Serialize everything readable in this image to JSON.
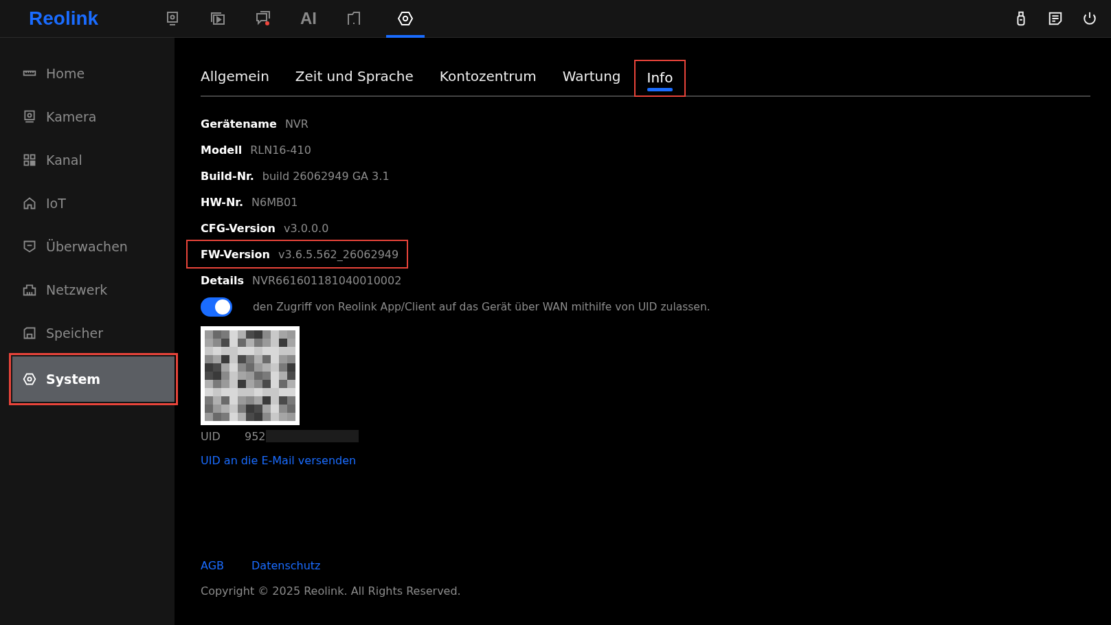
{
  "logo": "Reolink",
  "top_nav": [
    {
      "kind": "icon",
      "selected": false
    },
    {
      "kind": "icon",
      "selected": false
    },
    {
      "kind": "icon",
      "selected": false
    },
    {
      "kind": "text",
      "label": "AI",
      "selected": false
    },
    {
      "kind": "icon",
      "selected": false
    },
    {
      "kind": "icon",
      "selected": true
    }
  ],
  "sidebar": {
    "items": [
      {
        "label": "Home",
        "selected": false,
        "highlighted": false
      },
      {
        "label": "Kamera",
        "selected": false,
        "highlighted": false
      },
      {
        "label": "Kanal",
        "selected": false,
        "highlighted": false
      },
      {
        "label": "IoT",
        "selected": false,
        "highlighted": false
      },
      {
        "label": "Überwachen",
        "selected": false,
        "highlighted": false
      },
      {
        "label": "Netzwerk",
        "selected": false,
        "highlighted": false
      },
      {
        "label": "Speicher",
        "selected": false,
        "highlighted": false
      },
      {
        "label": "System",
        "selected": true,
        "highlighted": true
      }
    ]
  },
  "tabs": [
    {
      "label": "Allgemein",
      "selected": false,
      "highlighted": false
    },
    {
      "label": "Zeit und Sprache",
      "selected": false,
      "highlighted": false
    },
    {
      "label": "Kontozentrum",
      "selected": false,
      "highlighted": false
    },
    {
      "label": "Wartung",
      "selected": false,
      "highlighted": false
    },
    {
      "label": "Info",
      "selected": true,
      "highlighted": true
    }
  ],
  "info": [
    {
      "label": "Gerätename",
      "value": "NVR",
      "highlighted": false
    },
    {
      "label": "Modell",
      "value": "RLN16-410",
      "highlighted": false
    },
    {
      "label": "Build-Nr.",
      "value": "build 26062949 GA 3.1",
      "highlighted": false
    },
    {
      "label": "HW-Nr.",
      "value": "N6MB01",
      "highlighted": false
    },
    {
      "label": "CFG-Version",
      "value": "v3.0.0.0",
      "highlighted": false
    },
    {
      "label": "FW-Version",
      "value": "v3.6.5.562_26062949",
      "highlighted": true
    },
    {
      "label": "Details",
      "value": "NVR661601181040010002",
      "highlighted": false
    }
  ],
  "uid_access": {
    "on": true,
    "label": "den Zugriff von Reolink App/Client auf das Gerät über WAN mithilfe von UID zulassen."
  },
  "uid": {
    "label": "UID",
    "value": "952",
    "redacted": true
  },
  "send_uid_link": "UID an die E-Mail versenden",
  "footer_links": [
    "AGB",
    "Datenschutz"
  ],
  "copyright": "Copyright © 2025 Reolink. All Rights Reserved."
}
